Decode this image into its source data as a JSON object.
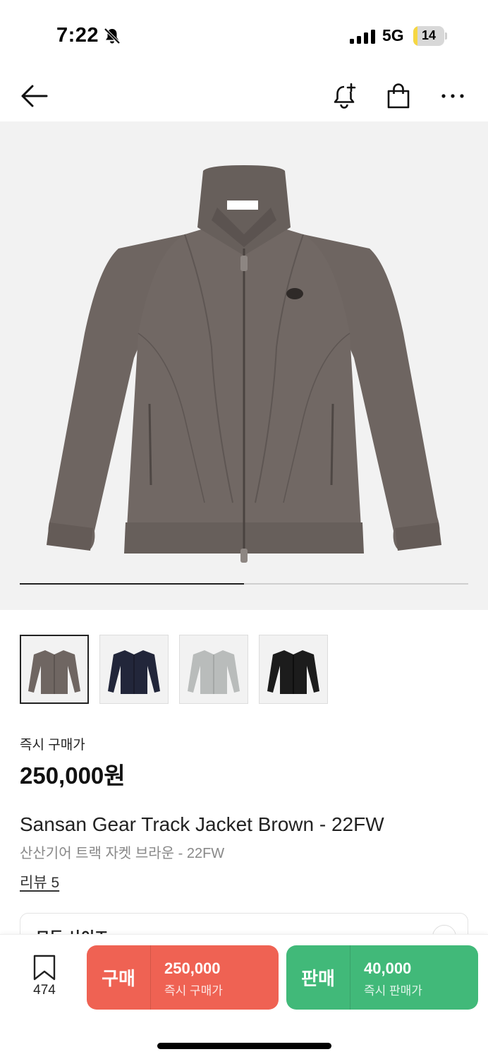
{
  "status_bar": {
    "time": "7:22",
    "network": "5G",
    "battery_level": "14",
    "battery_fraction": 0.14
  },
  "nav": {
    "back_icon": "arrow-left-icon",
    "icons": [
      "bell-plus-icon",
      "shopping-bag-icon",
      "more-icon"
    ]
  },
  "gallery": {
    "pager_progress": 0.5,
    "thumbnails": [
      {
        "name": "thumb-brown",
        "color": "#6f6662"
      },
      {
        "name": "thumb-navy",
        "color": "#22263a"
      },
      {
        "name": "thumb-gray",
        "color": "#b9bcbb"
      },
      {
        "name": "thumb-black",
        "color": "#1c1c1c"
      }
    ]
  },
  "product": {
    "price_label": "즉시 구매가",
    "price": "250,000원",
    "title_en": "Sansan Gear Track Jacket Brown - 22FW",
    "title_ko": "산산기어 트랙 자켓 브라운 - 22FW",
    "review_link": "리뷰 5"
  },
  "size_card": {
    "label": "모든 사이즈"
  },
  "bottom_bar": {
    "wish_count": "474",
    "buy": {
      "label": "구매",
      "price": "250,000",
      "sub": "즉시 구매가",
      "color": "#ef6253"
    },
    "sell": {
      "label": "판매",
      "price": "40,000",
      "sub": "즉시 판매가",
      "color": "#41b979"
    }
  }
}
